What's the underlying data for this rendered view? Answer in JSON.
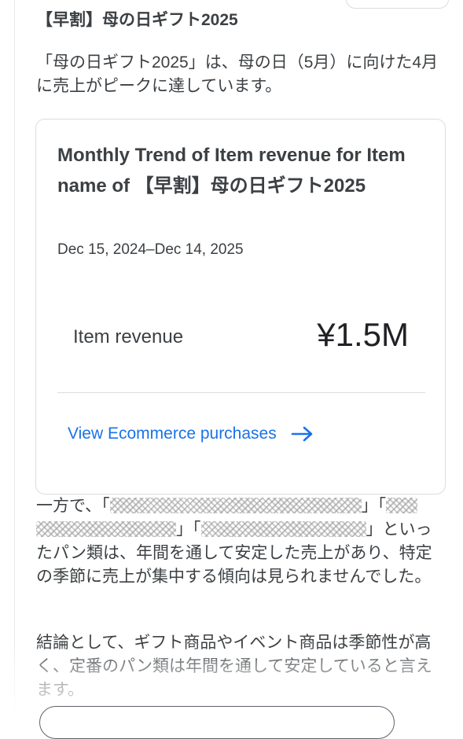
{
  "section_heading": "【早割】母の日ギフト2025",
  "paragraph1": "「母の日ギフト2025」は、母の日（5月）に向けた4月に売上がピークに達しています。",
  "card": {
    "title": "Monthly Trend of Item revenue for Item name of 【早割】母の日ギフト2025",
    "date_range": "Dec 15, 2024–Dec 14, 2025",
    "metric_label": "Item revenue",
    "metric_value": "¥1.5M",
    "link_label": "View Ecommerce purchases",
    "link_color": "#1a73e8"
  },
  "paragraph2": {
    "prefix": "一方で、「",
    "sep1": "」「",
    "sep2": "」「",
    "suffix": "」といったパン類は、年間を通して安定した売上があり、特定の季節に売上が集中する傾向は見られませんでした。"
  },
  "paragraph3": "結論として、ギフト商品やイベント商品は季節性が高く、定番のパン類は年間を通して安定していると言えます。"
}
